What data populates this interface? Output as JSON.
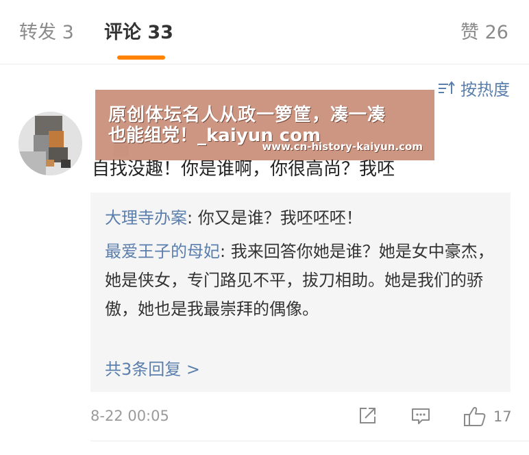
{
  "tabs": {
    "repost": "转发 3",
    "comments": "评论 33",
    "likes": "赞 26"
  },
  "sort": {
    "label": "按热度",
    "icon": "sort-icon"
  },
  "watermark": {
    "line1": "原创体坛名人从政一箩筐，凑一凑",
    "line2": "也能组党！_kaiyun com",
    "url": "www.cn-history-kaiyun.com"
  },
  "comment": {
    "text": "自找没趣！你是谁啊，你很高尚？我呸"
  },
  "replies": [
    {
      "user": "大理寺办案",
      "sep": ": ",
      "text": "你又是谁？我呸呸呸！"
    },
    {
      "user": "最爱王子的母妃",
      "sep": ": ",
      "text": "我来回答你她是谁？她是女中豪杰，她是侠女，专门路见不平，拔刀相助。她是我们的骄傲，她也是我最崇拜的偶像。"
    }
  ],
  "more_replies": "共3条回复 >",
  "footer": {
    "timestamp": "8-22 00:05",
    "like_count": "17"
  },
  "colors": {
    "accent": "#ff8200",
    "link": "#5b7fad",
    "muted": "#8a8a8a"
  }
}
